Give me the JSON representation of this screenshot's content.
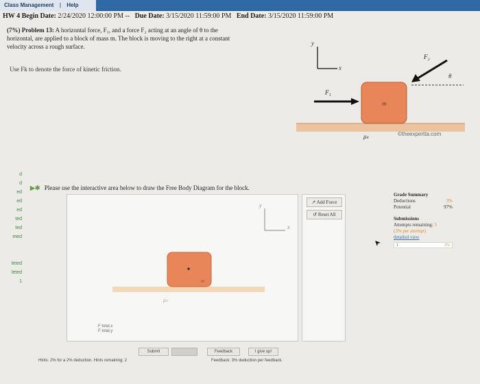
{
  "topbar": {
    "class_management": "Class Management",
    "separator": "|",
    "help": "Help"
  },
  "header": {
    "hw_title": "HW 4",
    "begin_label": "Begin Date:",
    "begin_value": "2/24/2020 12:00:00 PM -- ",
    "due_label": "Due Date:",
    "due_value": "3/15/2020 11:59:00 PM",
    "end_label": "End Date:",
    "end_value": "3/15/2020 11:59:00 PM"
  },
  "problem": {
    "label": "(7%) Problem 13:",
    "text_line1": "A horizontal force, F₁, and a force F₂ acting at an angle of θ to the",
    "text_line2": "horizontal, are applied to a block of mass m. The block is moving to the right at a constant",
    "text_line3": "velocity across a rough surface.",
    "hint": "Use Fk to denote the force of kinetic friction."
  },
  "diagram": {
    "axis_y": "y",
    "axis_x": "x",
    "force1": "F₁",
    "force2": "F₂",
    "angle": "θ",
    "mass": "m",
    "mu": "μₖ",
    "watermark": "©theexpertta.com",
    "colors": {
      "block": "#e8865a",
      "ground": "#ecc39e",
      "arrow": "#111111"
    }
  },
  "sidebar_strip": [
    "d",
    "d",
    "ed",
    "ed",
    "ed",
    "ted",
    "ted",
    "eted",
    "",
    "",
    "leted",
    "leted",
    "1"
  ],
  "fbd": {
    "instruction": "Please use the interactive area below to draw the Free Body Diagram for the block.",
    "axis_y": "y",
    "axis_x": "x",
    "mass": "m",
    "mu": "μₖ",
    "total_x": "F total,x",
    "total_y": "F total,y"
  },
  "tools": {
    "add_force": "Add Force",
    "reset_all": "Reset All"
  },
  "bottom": {
    "submit": "Submit",
    "feedback": "Feedback",
    "give_up": "I give up!",
    "hints_line": "Hints: 2% for a 2% deduction. Hints remaining: 2",
    "feedback_line": "Feedback: 3% deduction per feedback."
  },
  "grade": {
    "title": "Grade Summary",
    "deductions_label": "Deductions",
    "deductions_value": "3%",
    "potential_label": "Potential",
    "potential_value": "97%",
    "submissions_title": "Submissions",
    "attempts_label": "Attempts remaining:",
    "attempts_value": "5",
    "per_attempt": "(3% per attempt)",
    "detailed_view": "detailed view",
    "row_index": "1",
    "row_value": "3%"
  }
}
